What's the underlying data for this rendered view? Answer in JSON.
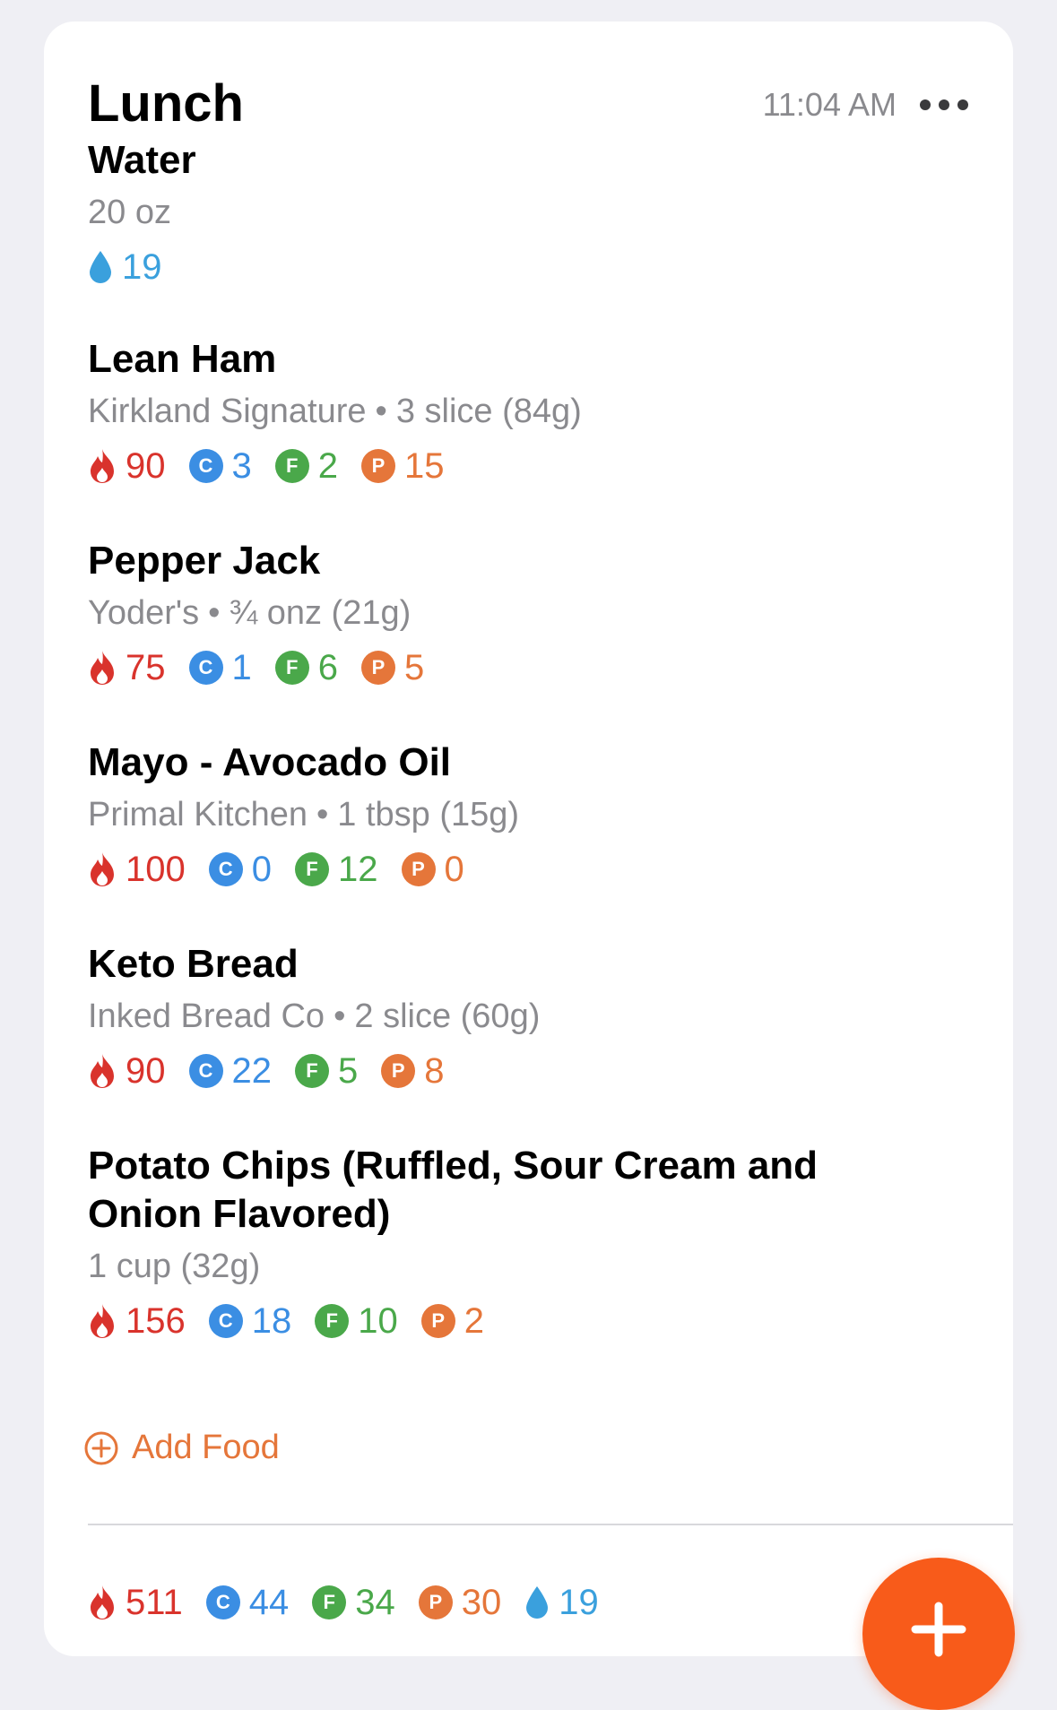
{
  "meal": {
    "title": "Lunch",
    "time": "11:04 AM"
  },
  "water_item": {
    "name": "Water",
    "amount": "20 oz",
    "water": "19"
  },
  "foods": [
    {
      "name": "Lean Ham",
      "brand": "Kirkland Signature",
      "serving": "3 slice (84g)",
      "cal": "90",
      "carb": "3",
      "fat": "2",
      "prot": "15"
    },
    {
      "name": "Pepper Jack",
      "brand": "Yoder's",
      "serving": "¾ onz (21g)",
      "cal": "75",
      "carb": "1",
      "fat": "6",
      "prot": "5"
    },
    {
      "name": "Mayo - Avocado Oil",
      "brand": "Primal Kitchen",
      "serving": "1 tbsp (15g)",
      "cal": "100",
      "carb": "0",
      "fat": "12",
      "prot": "0"
    },
    {
      "name": "Keto Bread",
      "brand": "Inked Bread Co",
      "serving": "2 slice (60g)",
      "cal": "90",
      "carb": "22",
      "fat": "5",
      "prot": "8"
    },
    {
      "name_line1": "Potato Chips (Ruffled, Sour Cream and",
      "name_line2": "Onion Flavored)",
      "serving": "1 cup (32g)",
      "cal": "156",
      "carb": "18",
      "fat": "10",
      "prot": "2"
    }
  ],
  "badges": {
    "carb": "C",
    "fat": "F",
    "prot": "P"
  },
  "separator": "•",
  "add_food_label": "Add Food",
  "totals": {
    "cal": "511",
    "carb": "44",
    "fat": "34",
    "prot": "30",
    "water": "19"
  },
  "colors": {
    "calories": "#d9332c",
    "carbs": "#3b8ee3",
    "fat": "#4aa84a",
    "protein": "#e5763a",
    "water": "#3aa0dd",
    "fab": "#f85b1a"
  },
  "icons": {
    "calories": "flame-icon",
    "water": "water-drop-icon",
    "more": "ellipsis-icon",
    "add_food": "plus-circle-icon",
    "fab": "plus-icon"
  }
}
